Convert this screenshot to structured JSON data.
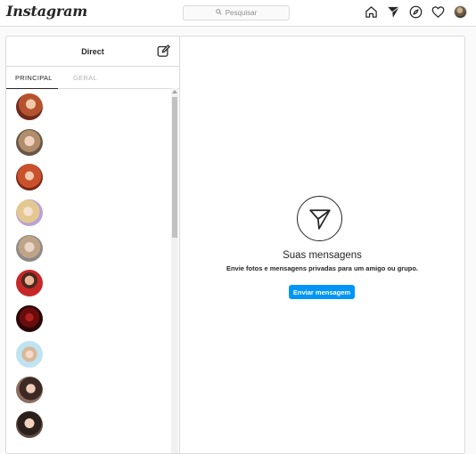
{
  "brand": {
    "logo_text": "Instagram"
  },
  "search": {
    "placeholder": "Pesquisar"
  },
  "nav": {
    "icons": [
      "home-icon",
      "direct-icon",
      "explore-icon",
      "activity-heart-icon",
      "profile-avatar"
    ]
  },
  "direct": {
    "title": "Direct",
    "tabs": [
      {
        "label": "PRINCIPAL",
        "active": true
      },
      {
        "label": "GERAL",
        "active": false
      }
    ],
    "threads": [
      {
        "avatar": "user-avatar-1"
      },
      {
        "avatar": "user-avatar-2"
      },
      {
        "avatar": "user-avatar-3"
      },
      {
        "avatar": "user-avatar-4"
      },
      {
        "avatar": "user-avatar-5"
      },
      {
        "avatar": "user-avatar-6"
      },
      {
        "avatar": "user-avatar-7"
      },
      {
        "avatar": "user-avatar-8"
      },
      {
        "avatar": "user-avatar-9"
      },
      {
        "avatar": "user-avatar-10"
      }
    ]
  },
  "empty_state": {
    "title": "Suas mensagens",
    "subtitle": "Envie fotos e mensagens privadas para um amigo ou grupo.",
    "button_label": "Enviar mensagem"
  },
  "colors": {
    "accent": "#0095f6",
    "border": "#dbdbdb",
    "text": "#262626",
    "muted": "#b3b3b3"
  }
}
